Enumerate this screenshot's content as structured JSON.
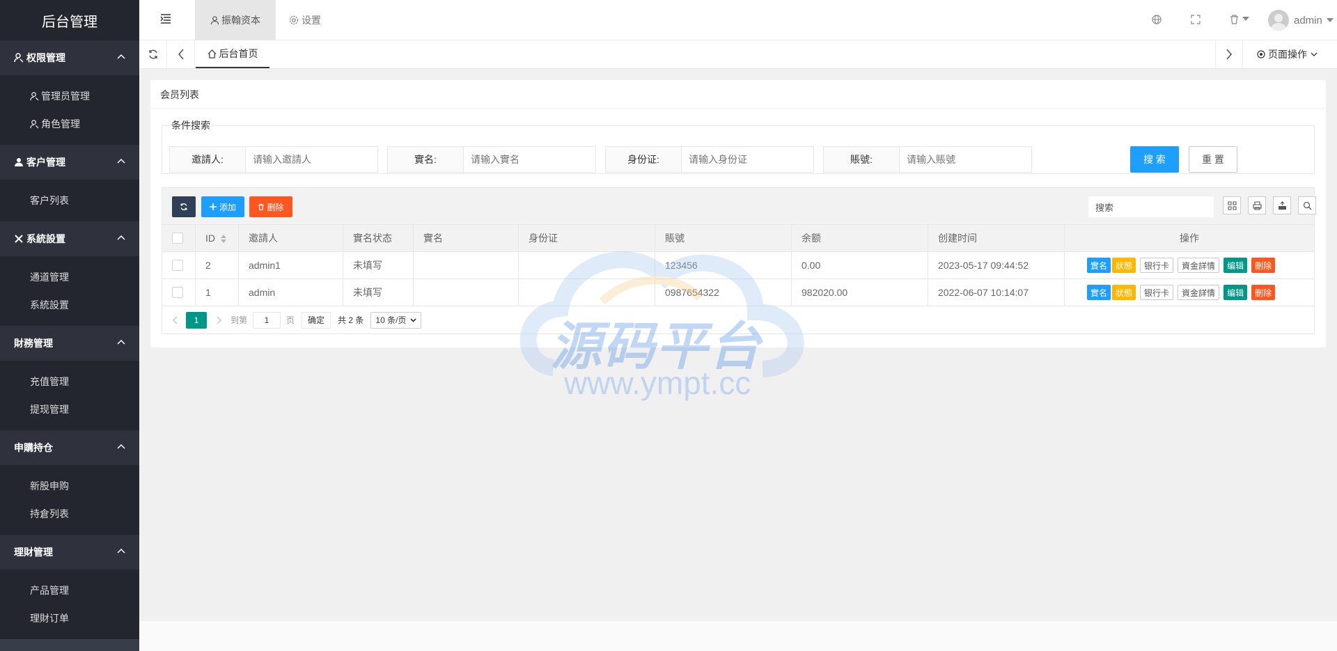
{
  "sidebar": {
    "logo": "后台管理",
    "groups": [
      {
        "label": "权限管理",
        "items": [
          "管理员管理",
          "角色管理"
        ]
      },
      {
        "label": "客户管理",
        "items": [
          "客户列表"
        ]
      },
      {
        "label": "系統設置",
        "items": [
          "通道管理",
          "系統設置"
        ]
      },
      {
        "label": "財務管理",
        "items": [
          "充值管理",
          "提现管理"
        ]
      },
      {
        "label": "申購持仓",
        "items": [
          "新股申购",
          "持倉列表"
        ]
      },
      {
        "label": "理財管理",
        "items": [
          "产品管理",
          "理財订单"
        ]
      }
    ]
  },
  "header": {
    "tab_active": "振翰资本",
    "tab_settings": "设置",
    "username": "admin"
  },
  "tabbar": {
    "home": "后台首页",
    "page_ops": "页面操作"
  },
  "card": {
    "title": "会员列表"
  },
  "search": {
    "legend": "条件搜索",
    "fields": [
      {
        "label": "邀請人:",
        "placeholder": "请输入邀請人"
      },
      {
        "label": "實名:",
        "placeholder": "请输入實名"
      },
      {
        "label": "身份证:",
        "placeholder": "请输入身份证"
      },
      {
        "label": "賬號:",
        "placeholder": "请输入賬號"
      }
    ],
    "search_btn": "搜 索",
    "reset_btn": "重 置"
  },
  "toolbar": {
    "add": "添加",
    "delete": "删除",
    "search_placeholder": "搜索"
  },
  "table": {
    "headers": [
      "ID",
      "邀請人",
      "實名状态",
      "實名",
      "身份证",
      "賬號",
      "余额",
      "创建时间",
      "操作"
    ],
    "rows": [
      {
        "id": "2",
        "inviter": "admin1",
        "status": "未填写",
        "name": "",
        "idcard": "",
        "account": "123456",
        "balance": "0.00",
        "created": "2023-05-17 09:44:52"
      },
      {
        "id": "1",
        "inviter": "admin",
        "status": "未填写",
        "name": "",
        "idcard": "",
        "account": "0987654322",
        "balance": "982020.00",
        "created": "2022-06-07 10:14:07"
      }
    ],
    "actions": [
      {
        "label": "實名",
        "color": "#1e9fff"
      },
      {
        "label": "狀態",
        "color": "#ffb800"
      },
      {
        "label": "银行卡",
        "color": "#ffffff"
      },
      {
        "label": "資金詳情",
        "color": "#ffffff"
      },
      {
        "label": "编辑",
        "color": "#009688"
      },
      {
        "label": "刪除",
        "color": "#ff5722"
      }
    ]
  },
  "pager": {
    "current": "1",
    "goto": "到第",
    "page_value": "1",
    "page_unit": "页",
    "confirm": "确定",
    "total": "共 2 条",
    "page_size": "10 条/页"
  },
  "watermark": {
    "title": "源码平台",
    "url": "www.ympt.cc"
  }
}
